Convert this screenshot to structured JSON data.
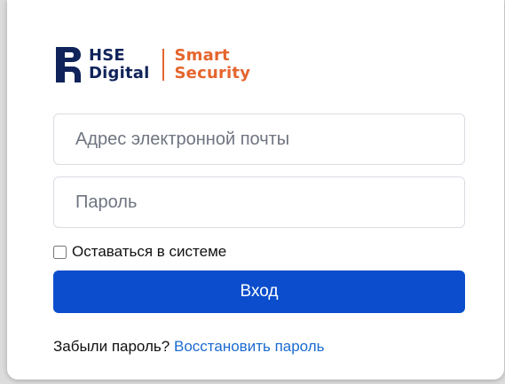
{
  "logo": {
    "line1": "HSE",
    "line2": "Digital",
    "product_line1": "Smart",
    "product_line2": "Security",
    "colors": {
      "brand_blue": "#10235a",
      "accent_orange": "#e5652e"
    }
  },
  "form": {
    "email_placeholder": "Адрес электронной почты",
    "email_value": "",
    "password_placeholder": "Пароль",
    "password_value": "",
    "remember_label": "Оставаться в системе",
    "remember_checked": false,
    "submit_label": "Вход",
    "submit_color": "#0b4dcc"
  },
  "footer": {
    "forgot_text": "Забыли пароль?",
    "restore_link": "Восстановить пароль",
    "link_color": "#1b6bd1"
  }
}
